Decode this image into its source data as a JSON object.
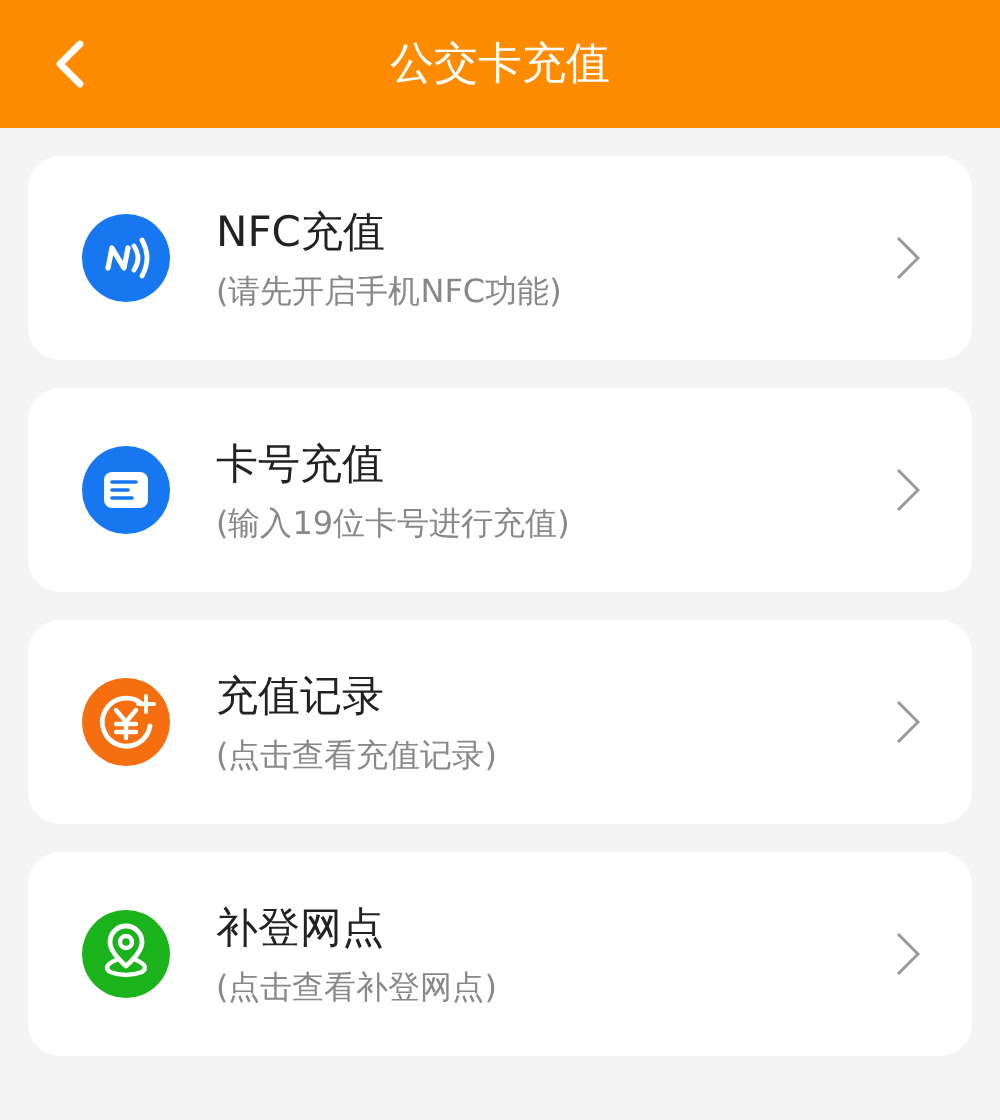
{
  "header": {
    "title": "公交卡充值"
  },
  "items": [
    {
      "kind": "nfc",
      "color": "#1677f0",
      "title": "NFC充值",
      "subtitle": "(请先开启手机NFC功能)"
    },
    {
      "kind": "card",
      "color": "#1677f0",
      "title": "卡号充值",
      "subtitle": "(输入19位卡号进行充值)"
    },
    {
      "kind": "money",
      "color": "#f56e0f",
      "title": "充值记录",
      "subtitle": "(点击查看充值记录)"
    },
    {
      "kind": "location",
      "color": "#1bb31b",
      "title": "补登网点",
      "subtitle": "(点击查看补登网点)"
    }
  ]
}
